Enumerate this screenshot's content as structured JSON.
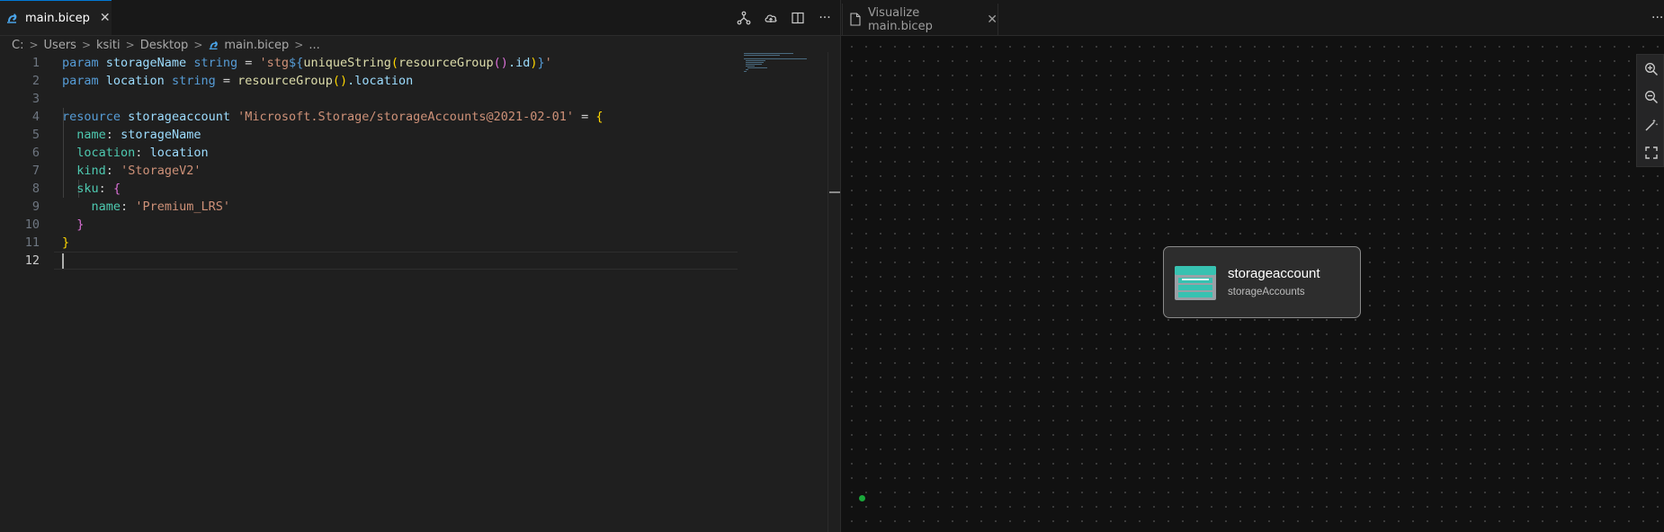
{
  "left_editor": {
    "tab": {
      "label": "main.bicep",
      "close": "✕"
    },
    "actions": {
      "more": "···"
    },
    "breadcrumb": {
      "drive": "C:",
      "users": "Users",
      "user": "ksiti",
      "desktop": "Desktop",
      "file": "main.bicep",
      "more": "...",
      "sep": ">"
    },
    "line_numbers": [
      "1",
      "2",
      "3",
      "4",
      "5",
      "6",
      "7",
      "8",
      "9",
      "10",
      "11",
      "12"
    ],
    "code": {
      "l1": {
        "kw": "param",
        "name": "storageName",
        "type": "string",
        "eq": "=",
        "str_a": "'stg",
        "interp_open": "${",
        "fn": "uniqueString",
        "paren1": "(",
        "fn2": "resourceGroup",
        "paren2": "()",
        "dot_id": ".id",
        "paren3": ")",
        "interp_close": "}",
        "str_b": "'"
      },
      "l2": {
        "kw": "param",
        "name": "location",
        "type": "string",
        "eq": "=",
        "fn": "resourceGroup",
        "paren": "()",
        "prop": ".location"
      },
      "l4": {
        "kw": "resource",
        "name": "storageaccount",
        "str": "'Microsoft.Storage/storageAccounts@2021-02-01'",
        "eq": "=",
        "brace": "{"
      },
      "l5": {
        "key": "name",
        "colon": ":",
        "val": "storageName"
      },
      "l6": {
        "key": "location",
        "colon": ":",
        "val": "location"
      },
      "l7": {
        "key": "kind",
        "colon": ":",
        "val": "'StorageV2'"
      },
      "l8": {
        "key": "sku",
        "colon": ":",
        "brace": "{"
      },
      "l9": {
        "key": "name",
        "colon": ":",
        "val": "'Premium_LRS'"
      },
      "l10": {
        "brace": "}"
      },
      "l11": {
        "brace": "}"
      }
    }
  },
  "right_editor": {
    "tab": {
      "label": "Visualize main.bicep",
      "close": "✕"
    },
    "more": "···",
    "node": {
      "title": "storageaccount",
      "subtitle": "storageAccounts"
    }
  },
  "colors": {
    "accent": "#0078d4",
    "keyword": "#569cd6",
    "string": "#ce9178",
    "function": "#dcdcaa",
    "status_ok": "#1aa83b"
  },
  "icons": [
    "bicep-icon",
    "visualize-icon",
    "deploy-cloud-icon",
    "split-editor-icon",
    "more-icon",
    "file-icon",
    "zoom-in-icon",
    "zoom-out-icon",
    "magic-wand-icon",
    "fit-view-icon",
    "storage-icon"
  ]
}
